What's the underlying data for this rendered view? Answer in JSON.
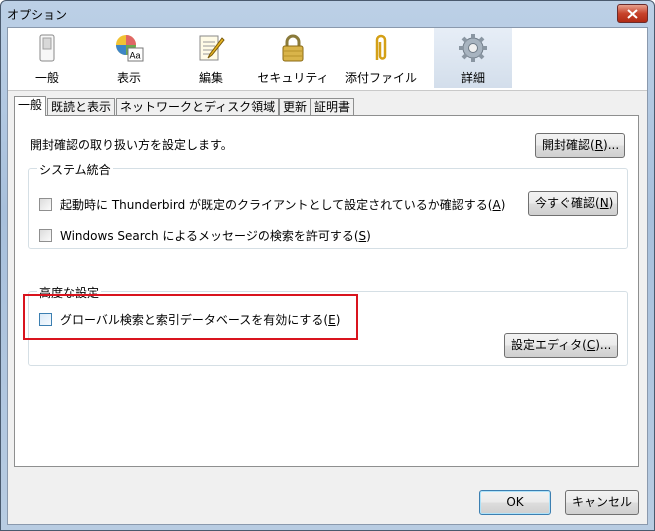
{
  "window": {
    "title": "オプション",
    "close_icon": "close-icon"
  },
  "toolbar": {
    "items": [
      {
        "label": "一般",
        "icon": "switch-icon"
      },
      {
        "label": "表示",
        "icon": "display-icon"
      },
      {
        "label": "編集",
        "icon": "notepad-icon"
      },
      {
        "label": "セキュリティ",
        "icon": "lock-icon"
      },
      {
        "label": "添付ファイル",
        "icon": "paperclip-icon"
      },
      {
        "label": "詳細",
        "icon": "gear-icon"
      }
    ],
    "selected": "詳細"
  },
  "subtabs": [
    "一般",
    "既読と表示",
    "ネットワークとディスク領域",
    "更新",
    "証明書"
  ],
  "general": {
    "receipt_text": "開封確認の取り扱い方を設定します。",
    "receipt_button": {
      "text": "開封確認(",
      "key": "R",
      "suffix": ")..."
    }
  },
  "system_integration": {
    "legend": "システム統合",
    "check_default": {
      "text": "起動時に Thunderbird が既定のクライアントとして設定されているか確認する(",
      "key": "A",
      "suffix": ")",
      "checked": false
    },
    "check_now_button": {
      "text": "今すぐ確認(",
      "key": "N",
      "suffix": ")"
    },
    "windows_search": {
      "text": "Windows Search によるメッセージの検索を許可する(",
      "key": "S",
      "suffix": ")",
      "checked": false
    }
  },
  "advanced": {
    "legend": "高度な設定",
    "global_search": {
      "text": "グローバル検索と索引データベースを有効にする(",
      "key": "E",
      "suffix": ")",
      "checked": false
    },
    "config_editor_button": {
      "text": "設定エディタ(",
      "key": "C",
      "suffix": ")..."
    }
  },
  "footer": {
    "ok": "OK",
    "cancel": "キャンセル"
  },
  "colors": {
    "highlight_box": "#d9141e",
    "selected_tool_bg": "#dbe5f1"
  }
}
